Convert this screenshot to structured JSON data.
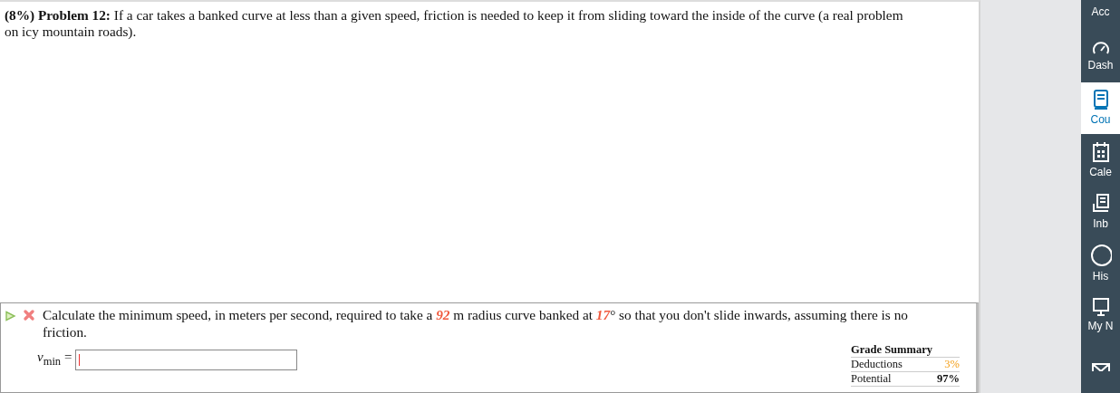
{
  "problem": {
    "statement": "**(8%)  Problem 12:**   If a car takes a banked curve at less than a given speed, friction is needed to keep it from sliding toward the inside of the curve (a real problem on icy mountain roads)."
  },
  "part": {
    "incorrect": true,
    "question": [
      {
        "kind": "plain",
        "text": "Calculate the minimum speed, in meters per second, required to take a "
      },
      {
        "kind": "given",
        "text": "92"
      },
      {
        "kind": "plain",
        "text": " m radius curve banked at "
      },
      {
        "kind": "given",
        "text": "17"
      },
      {
        "kind": "plain",
        "text": "° so that you don't slide inwards, assuming there is no friction."
      }
    ],
    "answer_label": "*v*$_{min}$ ="
  },
  "grade_summary": {
    "title": "Grade Summary",
    "rows": [
      {
        "label": "Deductions",
        "value": "3%",
        "kind": "deduction"
      },
      {
        "label": "Potential",
        "value": "97%",
        "kind": "potential"
      }
    ]
  },
  "nav": [
    {
      "label": "Acc",
      "selected": false
    },
    {
      "label": "Dash",
      "selected": false
    },
    {
      "label": "Cou",
      "selected": true
    },
    {
      "label": "Cale",
      "selected": false
    },
    {
      "label": "Inb",
      "selected": false
    },
    {
      "label": "His",
      "selected": false
    },
    {
      "label": "My N",
      "selected": false
    },
    {
      "selected": false
    }
  ]
}
